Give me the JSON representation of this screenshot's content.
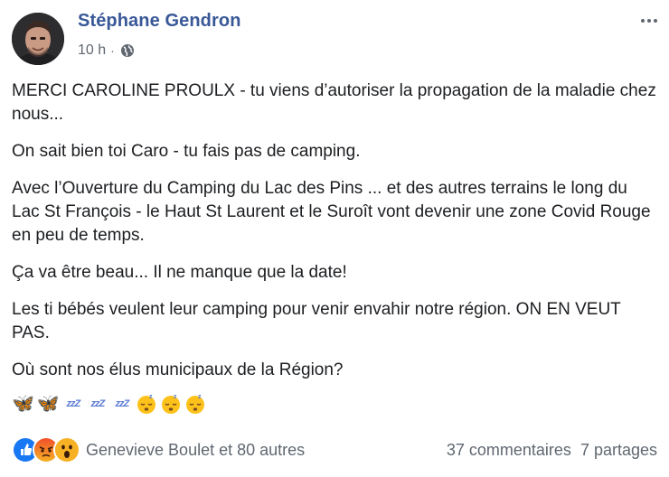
{
  "post": {
    "author": "Stéphane Gendron",
    "time": "10 h",
    "separator": "·",
    "privacy_icon": "globe-icon",
    "paragraphs": [
      "MERCI CAROLINE PROULX - tu viens d’autoriser la propagation de la maladie chez nous...",
      "On sait bien toi Caro - tu fais pas de camping.",
      "Avec l’Ouverture du Camping du Lac des Pins ... et des autres terrains le long du Lac St François - le Haut St Laurent et le Suroît vont devenir une zone Covid Rouge en peu de temps.",
      "Ça va être beau... Il ne manque que la date!",
      "Les ti bébés veulent leur camping pour venir envahir notre région. ON EN VEUT PAS.",
      "Où sont nos élus municipaux de la Région?"
    ],
    "emojis": [
      "butterfly",
      "butterfly",
      "zzz",
      "zzz",
      "zzz",
      "sleeping-face",
      "sleeping-face",
      "sleeping-face"
    ],
    "zzz_text": "zzZ",
    "butterfly_glyph": "🦋"
  },
  "reactions": {
    "icons": [
      "like-reaction-icon",
      "angry-reaction-icon",
      "wow-reaction-icon"
    ],
    "summary": "Genevieve Boulet et 80 autres",
    "comments": "37 commentaires",
    "shares": "7 partages"
  },
  "colors": {
    "author_link": "#385898",
    "meta_text": "#606770",
    "body_text": "#1c1e21",
    "like_blue": "#1877f2",
    "angry_red": "#e9710f",
    "wow_yellow": "#f7b125"
  }
}
